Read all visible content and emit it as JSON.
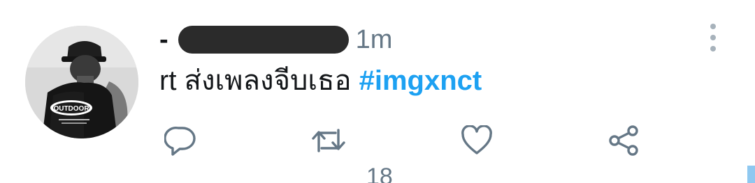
{
  "tweet": {
    "display_name": "-",
    "handle_redacted": true,
    "timestamp": "1m",
    "text": "rt ส่งเพลงจีบเธอ ",
    "hashtag": "#imgxnct"
  },
  "avatar": {
    "description_icon": "user-avatar",
    "shirt_logo_text": "OUTDOOR"
  },
  "actions": {
    "reply_icon": "reply-icon",
    "retweet_icon": "retweet-icon",
    "like_icon": "heart-icon",
    "share_icon": "share-icon",
    "more_icon": "more-vertical-icon"
  },
  "next_item": {
    "count_peek": "18"
  },
  "colors": {
    "hashtag": "#1da1f2",
    "icon": "#657786",
    "text": "#14171a"
  }
}
